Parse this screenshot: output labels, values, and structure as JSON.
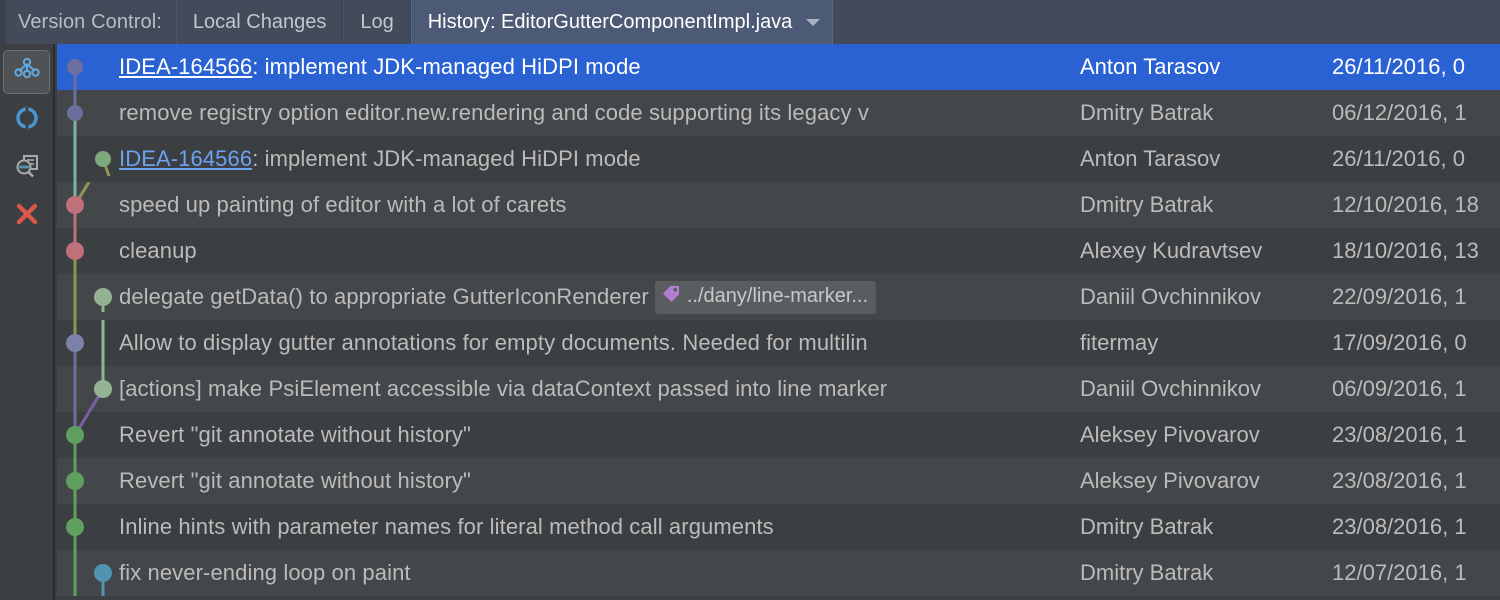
{
  "window": {
    "tool_title": "Version Control:",
    "tabs": [
      {
        "label": "Local Changes",
        "active": false
      },
      {
        "label": "Log",
        "active": false
      },
      {
        "label": "History: EditorGutterComponentImpl.java",
        "active": true
      }
    ],
    "caret_icon": "chevron-down-icon"
  },
  "toolstrip": {
    "buttons": [
      {
        "icon": "vcs-branches-icon",
        "selected": true,
        "color": "#62a8e0"
      },
      {
        "icon": "refresh-icon",
        "selected": false,
        "color": "#4a96d2"
      },
      {
        "icon": "show-diff-icon",
        "selected": false,
        "color": "#aaaaaa"
      },
      {
        "icon": "close-icon",
        "selected": false,
        "color": "#d9584a"
      }
    ]
  },
  "colors": {
    "selection": "#2a62d3",
    "row_even": "#3c3f41",
    "row_odd": "#434749",
    "text": "#bbbbbb",
    "link": "#6ba3f0",
    "tab_active": "#4d5a75",
    "header_bg": "#434a59",
    "node_purple": "#6c6f9e",
    "node_teal": "#7fb0ad",
    "node_red": "#c0707a",
    "node_olive": "#8f9655",
    "node_green": "#5fa05f",
    "node_sage": "#93b393",
    "node_blue": "#4f94b0",
    "node_violet": "#7d5fa8",
    "ref_chip_bg": "#5a5d5f",
    "ref_tag": "#b07fd0"
  },
  "commits": [
    {
      "id": "row-1",
      "selected": true,
      "issue": "IDEA-164566",
      "subject": ": implement JDK-managed HiDPI mode",
      "author": "Anton Tarasov",
      "date": "26/11/2016, 0",
      "ref": null
    },
    {
      "id": "row-2",
      "selected": false,
      "issue": null,
      "subject": "remove registry option editor.new.rendering and code supporting its legacy v",
      "author": "Dmitry Batrak",
      "date": "06/12/2016, 1",
      "ref": null
    },
    {
      "id": "row-3",
      "selected": false,
      "issue": "IDEA-164566",
      "subject": ": implement JDK-managed HiDPI mode",
      "author": "Anton Tarasov",
      "date": "26/11/2016, 0",
      "ref": null
    },
    {
      "id": "row-4",
      "selected": false,
      "issue": null,
      "subject": "speed up painting of editor with a lot of carets",
      "author": "Dmitry Batrak",
      "date": "12/10/2016, 18",
      "ref": null
    },
    {
      "id": "row-5",
      "selected": false,
      "issue": null,
      "subject": "cleanup",
      "author": "Alexey Kudravtsev",
      "date": "18/10/2016, 13",
      "ref": null
    },
    {
      "id": "row-6",
      "selected": false,
      "issue": null,
      "subject": "delegate getData() to appropriate GutterIconRenderer",
      "author": "Daniil Ovchinnikov",
      "date": "22/09/2016, 1",
      "ref": "../dany/line-marker..."
    },
    {
      "id": "row-7",
      "selected": false,
      "issue": null,
      "subject": "Allow to display gutter annotations for empty documents. Needed for multilin",
      "author": "fitermay",
      "date": "17/09/2016, 0",
      "ref": null
    },
    {
      "id": "row-8",
      "selected": false,
      "issue": null,
      "subject": "[actions] make PsiElement accessible via dataContext passed into line marker",
      "author": "Daniil Ovchinnikov",
      "date": "06/09/2016, 1",
      "ref": null
    },
    {
      "id": "row-9",
      "selected": false,
      "issue": null,
      "subject": "Revert \"git annotate without history\"",
      "author": "Aleksey Pivovarov",
      "date": "23/08/2016, 1",
      "ref": null
    },
    {
      "id": "row-10",
      "selected": false,
      "issue": null,
      "subject": "Revert \"git annotate without history\"",
      "author": "Aleksey Pivovarov",
      "date": "23/08/2016, 1",
      "ref": null
    },
    {
      "id": "row-11",
      "selected": false,
      "issue": null,
      "subject": "Inline hints with parameter names for literal method call arguments",
      "author": "Dmitry Batrak",
      "date": "23/08/2016, 1",
      "ref": null
    },
    {
      "id": "row-12",
      "selected": false,
      "issue": null,
      "subject": "fix never-ending loop on paint",
      "author": "Dmitry Batrak",
      "date": "12/07/2016, 1",
      "ref": null
    }
  ]
}
